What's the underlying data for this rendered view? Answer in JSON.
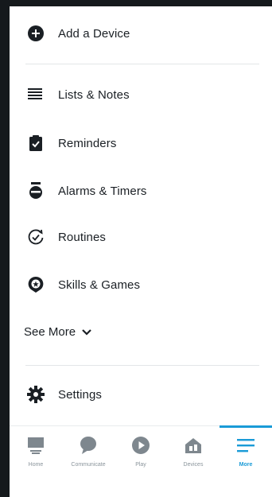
{
  "menu": {
    "add_device": "Add a Device",
    "lists_notes": "Lists & Notes",
    "reminders": "Reminders",
    "alarms_timers": "Alarms & Timers",
    "routines": "Routines",
    "skills_games": "Skills & Games",
    "see_more": "See More",
    "settings": "Settings"
  },
  "nav": {
    "home": "Home",
    "communicate": "Communicate",
    "play": "Play",
    "devices": "Devices",
    "more": "More",
    "active": "More"
  },
  "colors": {
    "accent": "#1a9bd7",
    "icon_dark": "#1a1f24",
    "nav_icon_gray": "#7e878e",
    "frame_bg": "#15191c"
  }
}
